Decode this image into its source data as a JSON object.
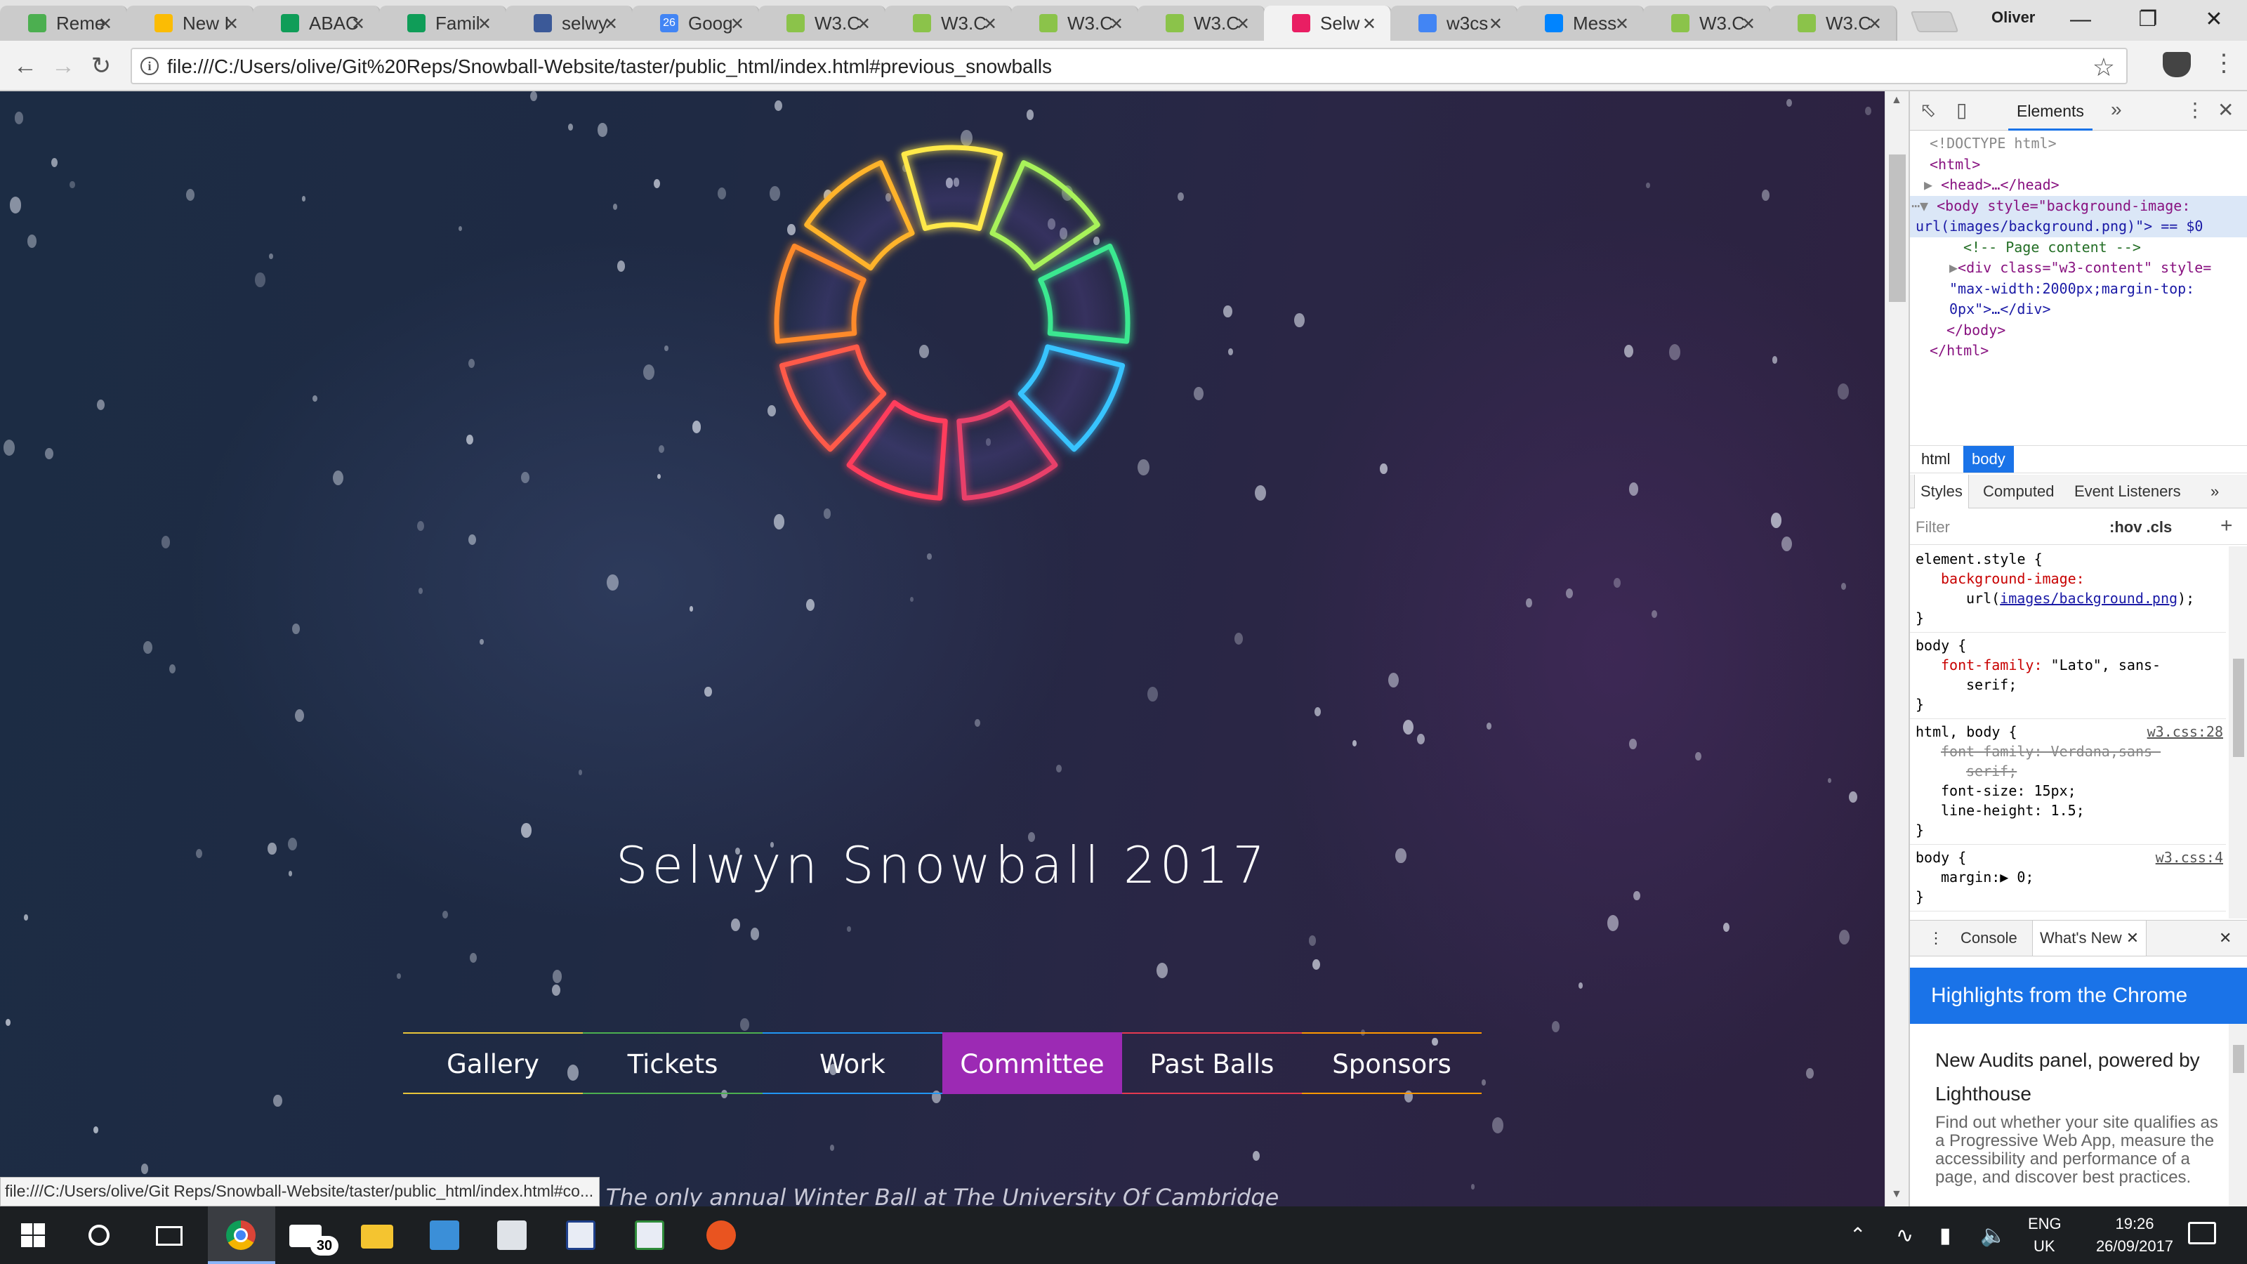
{
  "browser": {
    "tabs": [
      {
        "title": "Reme",
        "favicon": "google-play-icon",
        "color": "#4caf50"
      },
      {
        "title": "New I",
        "favicon": "google-drive-icon",
        "color": "#fbbc04"
      },
      {
        "title": "ABAC",
        "favicon": "google-sheets-icon",
        "color": "#0f9d58"
      },
      {
        "title": "Famil",
        "favicon": "google-sheets-icon",
        "color": "#0f9d58"
      },
      {
        "title": "selwy",
        "favicon": "facebook-icon",
        "color": "#3b5998"
      },
      {
        "title": "Goog",
        "favicon": "google-calendar-icon",
        "color": "#4285f4",
        "badge": "26"
      },
      {
        "title": "W3.C",
        "favicon": "w3c-icon",
        "color": "#8bc34a"
      },
      {
        "title": "W3.C",
        "favicon": "w3c-icon",
        "color": "#8bc34a"
      },
      {
        "title": "W3.C",
        "favicon": "w3c-icon",
        "color": "#8bc34a"
      },
      {
        "title": "W3.C",
        "favicon": "w3c-icon",
        "color": "#8bc34a"
      },
      {
        "title": "Selw",
        "favicon": "snowball-icon",
        "color": "#e91e63",
        "active": true
      },
      {
        "title": "w3cs",
        "favicon": "google-icon",
        "color": "#4285f4"
      },
      {
        "title": "Mess",
        "favicon": "messenger-icon",
        "color": "#0084ff"
      },
      {
        "title": "W3.C",
        "favicon": "w3c-icon",
        "color": "#8bc34a"
      },
      {
        "title": "W3.C",
        "favicon": "w3c-icon",
        "color": "#8bc34a"
      }
    ],
    "profile_name": "Oliver",
    "close_glyph": "✕",
    "url": "file:///C:/Users/olive/Git%20Reps/Snowball-Website/taster/public_html/index.html#previous_snowballs",
    "status_url": "file:///C:/Users/olive/Git Reps/Snowball-Website/taster/public_html/index.html#co..."
  },
  "page": {
    "title": "Selwyn Snowball 2017",
    "nav": [
      {
        "label": "Gallery",
        "color": "#e8c53a"
      },
      {
        "label": "Tickets",
        "color": "#4caf50"
      },
      {
        "label": "Work",
        "color": "#2196f3"
      },
      {
        "label": "Committee",
        "color": "#9c2ab4",
        "active": true
      },
      {
        "label": "Past Balls",
        "color": "#e53950"
      },
      {
        "label": "Sponsors",
        "color": "#ff9800"
      }
    ],
    "tagline": "The only annual Winter Ball at The University Of Cambridge",
    "logo_segment_colors": [
      "#ffe94a",
      "#a8f25a",
      "#3be890",
      "#38c4ff",
      "#e8406a",
      "#ff3c5c",
      "#ff5a4a",
      "#ff8a2a",
      "#ffb32a"
    ]
  },
  "devtools": {
    "tab_elements": "Elements",
    "dom": {
      "doctype": "<!DOCTYPE html>",
      "html_open": "<html>",
      "head": "<head>…</head>",
      "body_line1": "<body style=\"background-image:",
      "body_line2": "url(images/background.png)\"> == $0",
      "comment": "<!-- Page content -->",
      "div_line1": "<div class=\"w3-content\" style=",
      "div_line2": "\"max-width:2000px;margin-top:",
      "div_line3": "0px\">…</div>",
      "body_close": "</body>",
      "html_close": "</html>"
    },
    "breadcrumbs": [
      "html",
      "body"
    ],
    "styles_tabs": [
      "Styles",
      "Computed",
      "Event Listeners"
    ],
    "filter_placeholder": "Filter",
    "hov_cls": ":hov  .cls",
    "rules": {
      "element_style_selector": "element.style {",
      "bg_prop": "background-image:",
      "bg_value_prefix": "url(",
      "bg_link": "images/background.png",
      "bg_value_suffix": ");",
      "body_selector": "body {",
      "font_family_prop": "font-family:",
      "font_family_value": "\"Lato\", sans-",
      "font_family_value2": "serif;",
      "html_body_selector": "html, body {",
      "html_body_source": "w3.css:28",
      "struck_line1": "font-family: Verdana,sans-",
      "struck_line2": "serif;",
      "font_size": "font-size: 15px;",
      "line_height": "line-height: 1.5;",
      "body2_selector": "body {",
      "body2_source": "w3.css:4",
      "margin": "margin:▶ 0;",
      "closing_brace": "}"
    },
    "drawer_tabs": [
      "Console",
      "What's New"
    ],
    "whats_new_banner": "Highlights from the Chrome",
    "whats_new_heading": "New Audits panel, powered by Lighthouse",
    "whats_new_desc": "Find out whether your site qualifies as a Progressive Web App, measure the accessibility and performance of a page, and discover best practices."
  },
  "taskbar": {
    "mail_badge": "30",
    "lang_top": "ENG",
    "lang_bottom": "UK",
    "time": "19:26",
    "date": "26/09/2017"
  }
}
